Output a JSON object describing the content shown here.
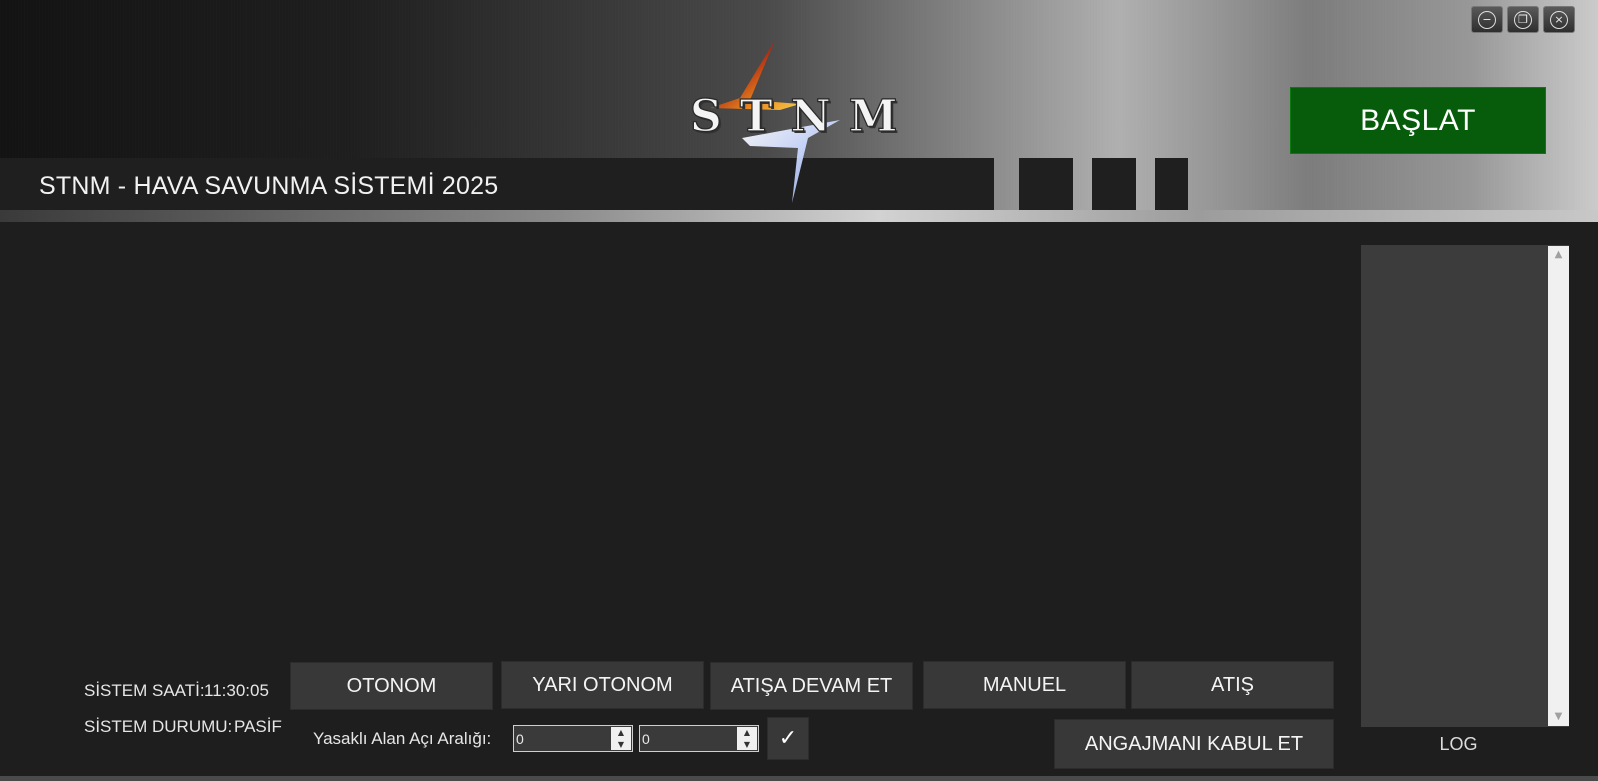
{
  "header": {
    "title": "STNM - HAVA SAVUNMA SİSTEMİ 2025",
    "logo_text": "STNM",
    "start_button_label": "BAŞLAT",
    "window_controls": {
      "minimize_icon": "minimize-icon",
      "restore_icon": "restore-icon",
      "close_icon": "close-icon"
    }
  },
  "status": {
    "time_label": "SİSTEM SAATİ:",
    "time_value": "11:30:05",
    "state_label": "SİSTEM DURUMU:",
    "state_value": "PASİF"
  },
  "mode_buttons": {
    "autonomous": "OTONOM",
    "semi_autonomous": "YARI OTONOM",
    "continue_fire": "ATIŞA DEVAM ET",
    "manual": "MANUEL",
    "fire": "ATIŞ",
    "accept_engagement": "ANGAJMANI KABUL ET"
  },
  "forbidden_zone": {
    "label": "Yasaklı Alan Açı Aralığı:",
    "min_value": "0",
    "max_value": "0",
    "confirm_icon": "✓"
  },
  "log": {
    "label": "LOG"
  },
  "colors": {
    "background": "#1e1e1e",
    "start_button": "#075c0b",
    "button": "#383838",
    "log_panel": "#3c3c3c"
  }
}
